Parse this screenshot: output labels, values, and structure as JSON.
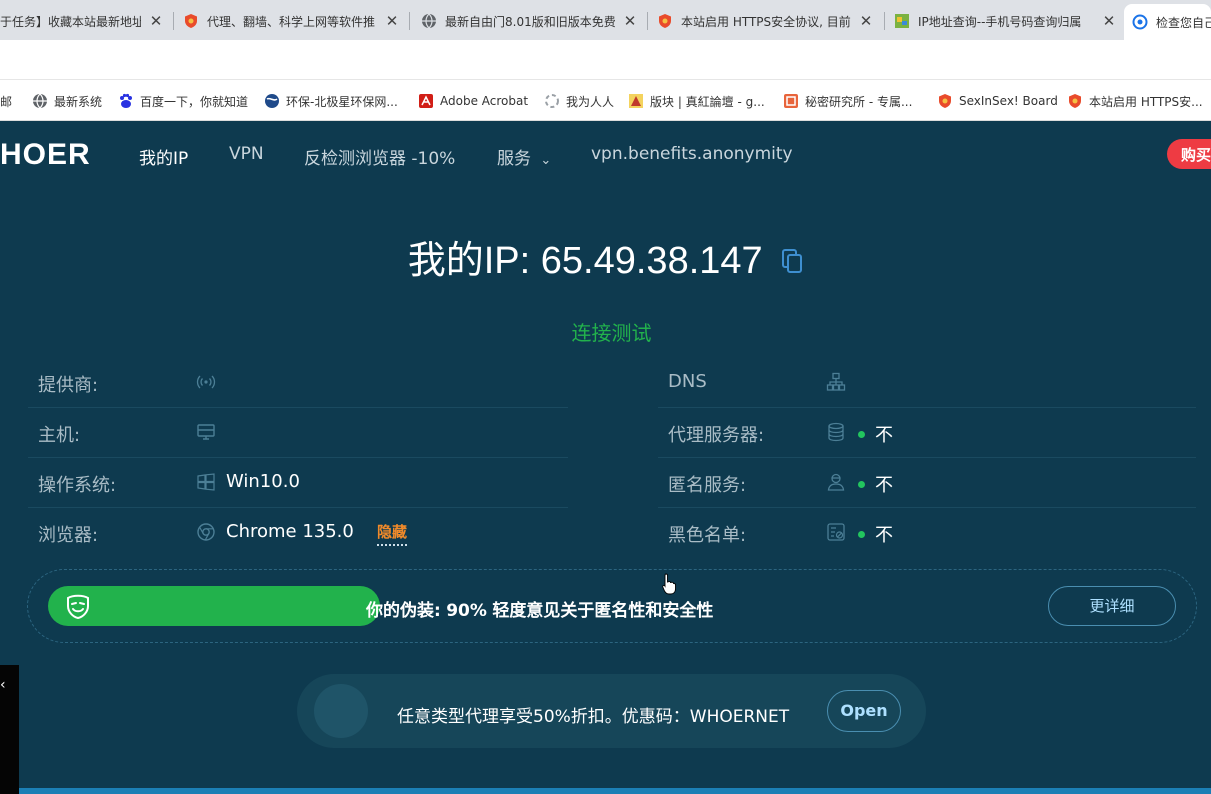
{
  "browser": {
    "tabs": [
      {
        "title": "于任务】收藏本站最新地址",
        "favicon": "page-icon"
      },
      {
        "title": "代理、翻墙、科学上网等软件推",
        "favicon": "shield-icon"
      },
      {
        "title": "最新自由门8.01版和旧版本免费",
        "favicon": "globe-icon"
      },
      {
        "title": "本站启用 HTTPS安全协议, 目前",
        "favicon": "shield-icon"
      },
      {
        "title": "IP地址查询--手机号码查询归属",
        "favicon": "map-icon"
      },
      {
        "title": "检查您自己",
        "favicon": "whoer-icon"
      }
    ],
    "tab_close": "✕",
    "bookmarks": [
      {
        "label": "邮",
        "favicon": "mail-icon"
      },
      {
        "label": "最新系统",
        "favicon": "globe-icon"
      },
      {
        "label": "百度一下，你就知道",
        "favicon": "baidu-icon"
      },
      {
        "label": "环保-北极星环保网...",
        "favicon": "earth-icon"
      },
      {
        "label": "Adobe Acrobat",
        "favicon": "acrobat-icon"
      },
      {
        "label": "我为人人",
        "favicon": "loading-icon"
      },
      {
        "label": "版块 | 真紅論壇 - g...",
        "favicon": "forum-icon"
      },
      {
        "label": "秘密研究所 - 专属...",
        "favicon": "lab-icon"
      },
      {
        "label": "SexInSex! Board",
        "favicon": "shield-icon"
      },
      {
        "label": "本站启用 HTTPS安...",
        "favicon": "shield-icon"
      }
    ]
  },
  "nav": {
    "logo": "HOER",
    "links": [
      "我的IP",
      "VPN",
      "反检测浏览器 -10%",
      "服务",
      "vpn.benefits.anonymity"
    ],
    "services_caret": "⌄",
    "buy": "购买"
  },
  "ip": {
    "label": "我的IP:",
    "value": "65.49.38.147"
  },
  "test_link": "连接测试",
  "left_rows": [
    {
      "label": "提供商:",
      "value": "",
      "icon": "signal-icon"
    },
    {
      "label": "主机:",
      "value": "",
      "icon": "monitor-icon"
    },
    {
      "label": "操作系统:",
      "value": "Win10.0",
      "icon": "windows-icon"
    },
    {
      "label": "浏览器:",
      "value": "Chrome 135.0",
      "icon": "chrome-icon",
      "tag": "隐藏"
    }
  ],
  "right_rows": [
    {
      "label": "DNS",
      "value": "",
      "icon": "network-icon"
    },
    {
      "label": "代理服务器:",
      "value": "不",
      "icon": "database-icon"
    },
    {
      "label": "匿名服务:",
      "value": "不",
      "icon": "user-icon"
    },
    {
      "label": "黑色名单:",
      "value": "不",
      "icon": "blacklist-icon"
    }
  ],
  "disguise": {
    "label": "你的伪装:",
    "percent": 90,
    "percent_text": "90%",
    "note": "轻度意见关于匿名性和安全性",
    "more_button": "更详细"
  },
  "promo": {
    "text": "任意类型代理享受50%折扣。优惠码：WHOERNET",
    "open_button": "Open"
  },
  "side_widget": {
    "glyph": "‹"
  },
  "colors": {
    "page_bg": "#0e3a4f",
    "accent_green": "#22b24c",
    "buy_red": "#ee3b43",
    "tag_orange": "#f08a2a"
  }
}
